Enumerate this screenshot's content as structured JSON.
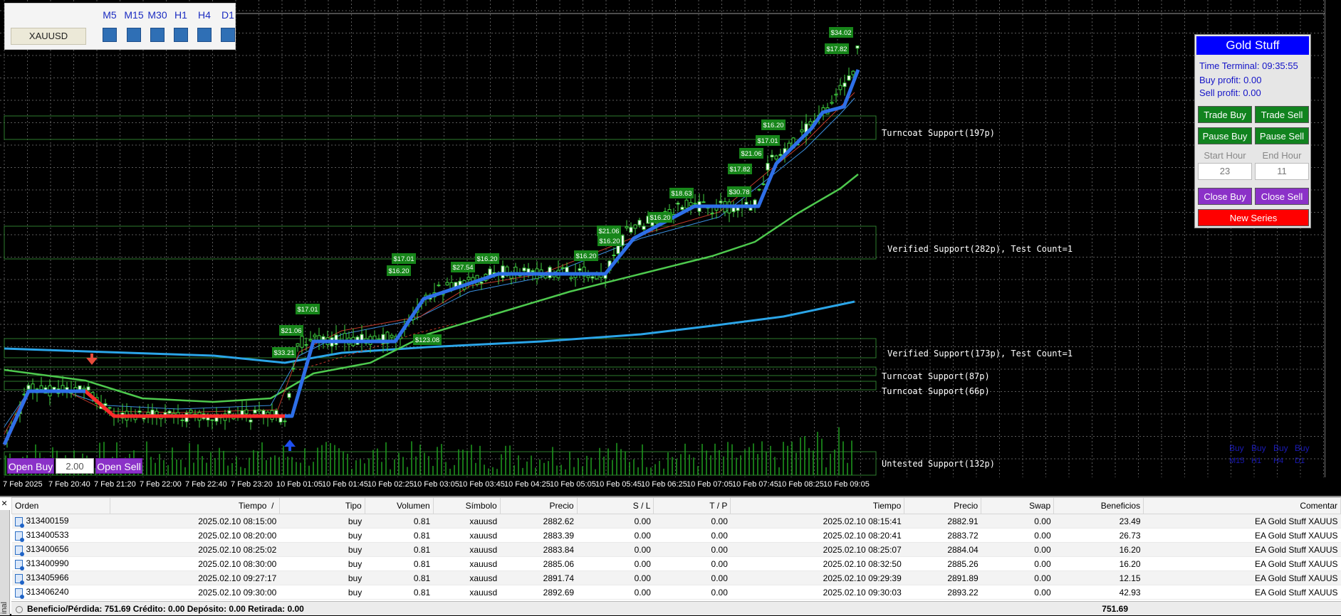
{
  "timeframe_panel": {
    "symbol": "XAUUSD",
    "timeframes": [
      "M5",
      "M15",
      "M30",
      "H1",
      "H4",
      "D1"
    ]
  },
  "gold_panel": {
    "title": "Gold Stuff",
    "time_terminal": "Time Terminal: 09:35:55",
    "buy_profit": "Buy profit: 0.00",
    "sell_profit": "Sell profit: 0.00",
    "trade_buy": "Trade Buy",
    "trade_sell": "Trade Sell",
    "pause_buy": "Pause Buy",
    "pause_sell": "Pause Sell",
    "start_hour_label": "Start Hour",
    "end_hour_label": "End Hour",
    "start_hour": "23",
    "end_hour": "11",
    "close_buy": "Close Buy",
    "close_sell": "Close Sell",
    "new_series": "New Series",
    "colors": {
      "title": "#0000ff",
      "green": "#11831f",
      "purple": "#8b31c8",
      "red": "#ff0000"
    }
  },
  "order_panel": {
    "open_buy": "Open Buy",
    "lot": "2.00",
    "open_sell": "Open Sell"
  },
  "zones": [
    "Turncoat Support(197p)",
    "Verified Support(282p), Test Count=1",
    "Verified Support(173p), Test Count=1",
    "Turncoat Support(87p)",
    "Turncoat Support(66p)",
    "Untested Support(132p)"
  ],
  "buy_signals": {
    "row1": [
      "Buy",
      "Buy",
      "Buy",
      "Buy"
    ],
    "row2": [
      "M15",
      "H1",
      "H4",
      "D1"
    ]
  },
  "trade_labels": [
    "$34.02",
    "$17.82",
    "$16.20",
    "$17.01",
    "$21.06",
    "$17.82",
    "$30.78",
    "$18.63",
    "$16.20",
    "$21.06",
    "$16.20",
    "$16.20",
    "$27.54",
    "$16.20",
    "$17.01",
    "$16.20",
    "$17.01",
    "$21.06",
    "$33.21",
    "$123.08"
  ],
  "time_axis": [
    "7 Feb 2025",
    "7 Feb 20:40",
    "7 Feb 21:20",
    "7 Feb 22:00",
    "7 Feb 22:40",
    "7 Feb 23:20",
    "10 Feb 01:05",
    "10 Feb 01:45",
    "10 Feb 02:25",
    "10 Feb 03:05",
    "10 Feb 03:45",
    "10 Feb 04:25",
    "10 Feb 05:05",
    "10 Feb 05:45",
    "10 Feb 06:25",
    "10 Feb 07:05",
    "10 Feb 07:45",
    "10 Feb 08:25",
    "10 Feb 09:05"
  ],
  "terminal": {
    "close_icon": "×",
    "side_label": "inal",
    "headers": [
      "Orden",
      "Tiempo",
      "Tipo",
      "Volumen",
      "Símbolo",
      "Precio",
      "S / L",
      "T / P",
      "Tiempo",
      "Precio",
      "Swap",
      "Beneficios",
      "Comentar"
    ],
    "sort_marker": "/",
    "rows": [
      [
        "313400159",
        "2025.02.10 08:15:00",
        "buy",
        "0.81",
        "xauusd",
        "2882.62",
        "0.00",
        "0.00",
        "2025.02.10 08:15:41",
        "2882.91",
        "0.00",
        "23.49",
        "EA Gold Stuff XAUUS"
      ],
      [
        "313400533",
        "2025.02.10 08:20:00",
        "buy",
        "0.81",
        "xauusd",
        "2883.39",
        "0.00",
        "0.00",
        "2025.02.10 08:20:41",
        "2883.72",
        "0.00",
        "26.73",
        "EA Gold Stuff XAUUS"
      ],
      [
        "313400656",
        "2025.02.10 08:25:02",
        "buy",
        "0.81",
        "xauusd",
        "2883.84",
        "0.00",
        "0.00",
        "2025.02.10 08:25:07",
        "2884.04",
        "0.00",
        "16.20",
        "EA Gold Stuff XAUUS"
      ],
      [
        "313400990",
        "2025.02.10 08:30:00",
        "buy",
        "0.81",
        "xauusd",
        "2885.06",
        "0.00",
        "0.00",
        "2025.02.10 08:32:50",
        "2885.26",
        "0.00",
        "16.20",
        "EA Gold Stuff XAUUS"
      ],
      [
        "313405966",
        "2025.02.10 09:27:17",
        "buy",
        "0.81",
        "xauusd",
        "2891.74",
        "0.00",
        "0.00",
        "2025.02.10 09:29:39",
        "2891.89",
        "0.00",
        "12.15",
        "EA Gold Stuff XAUUS"
      ],
      [
        "313406240",
        "2025.02.10 09:30:00",
        "buy",
        "0.81",
        "xauusd",
        "2892.69",
        "0.00",
        "0.00",
        "2025.02.10 09:30:03",
        "2893.22",
        "0.00",
        "42.93",
        "EA Gold Stuff XAUUS"
      ]
    ],
    "balance_summary": "Beneficio/Pérdida: 751.69  Crédito: 0.00  Depósito: 0.00  Retirada: 0.00",
    "balance_total": "751.69"
  }
}
